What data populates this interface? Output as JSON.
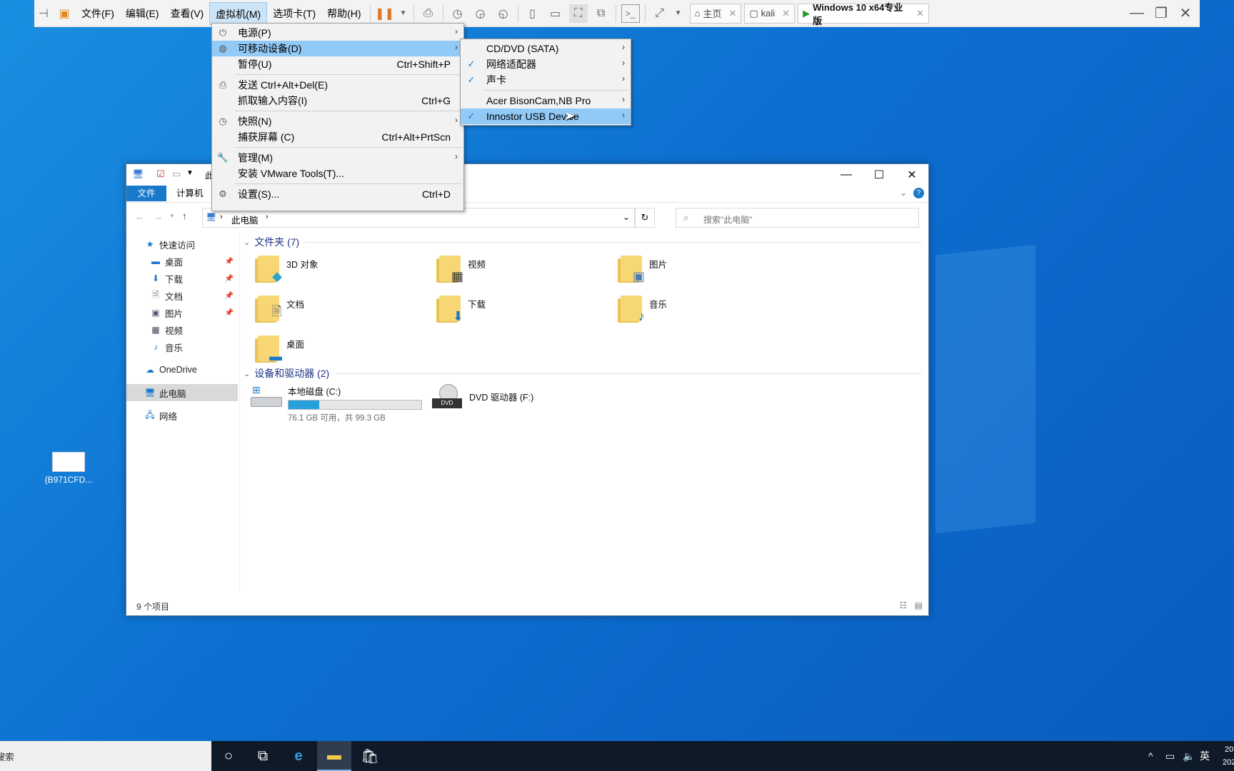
{
  "vmware": {
    "menus": [
      "文件(F)",
      "编辑(E)",
      "查看(V)",
      "虚拟机(M)",
      "选项卡(T)",
      "帮助(H)"
    ],
    "tabs": [
      {
        "label": "主页"
      },
      {
        "label": "kali"
      },
      {
        "label": "Windows 10 x64专业版"
      }
    ]
  },
  "vm_menu": {
    "items": [
      {
        "label": "电源(P)",
        "shortcut": "",
        "submenu": true,
        "icon": "power-icon"
      },
      {
        "label": "可移动设备(D)",
        "shortcut": "",
        "submenu": true,
        "icon": "removable-device-icon"
      },
      {
        "label": "暂停(U)",
        "shortcut": "Ctrl+Shift+P",
        "submenu": false
      },
      {
        "label": "发送 Ctrl+Alt+Del(E)",
        "shortcut": "",
        "submenu": false,
        "icon": "keyboard-send-icon"
      },
      {
        "label": "抓取输入内容(I)",
        "shortcut": "Ctrl+G",
        "submenu": false
      },
      {
        "label": "快照(N)",
        "shortcut": "",
        "submenu": true,
        "icon": "snapshot-icon"
      },
      {
        "label": "捕获屏幕 (C)",
        "shortcut": "Ctrl+Alt+PrtScn",
        "submenu": false
      },
      {
        "label": "管理(M)",
        "shortcut": "",
        "submenu": true,
        "icon": "wrench-icon"
      },
      {
        "label": "安装 VMware Tools(T)...",
        "shortcut": "",
        "submenu": false
      },
      {
        "label": "设置(S)...",
        "shortcut": "Ctrl+D",
        "submenu": false,
        "icon": "settings-icon"
      }
    ]
  },
  "device_menu": {
    "items": [
      {
        "label": "CD/DVD (SATA)",
        "checked": false
      },
      {
        "label": "网络适配器",
        "checked": true
      },
      {
        "label": "声卡",
        "checked": true
      },
      {
        "label": "Acer BisonCam,NB Pro",
        "checked": false
      },
      {
        "label": "Innostor USB Device",
        "checked": true
      }
    ]
  },
  "explorer": {
    "title_short": "此",
    "ribbon_tabs": [
      "文件",
      "计算机"
    ],
    "breadcrumb": "此电脑",
    "search_placeholder": "搜索\"此电脑\"",
    "nav": {
      "quick_access": "快速访问",
      "items": [
        "桌面",
        "下载",
        "文档",
        "图片",
        "视频",
        "音乐"
      ],
      "onedrive": "OneDrive",
      "this_pc": "此电脑",
      "network": "网络"
    },
    "folders_header": "文件夹 (7)",
    "folders": [
      "3D 对象",
      "视频",
      "图片",
      "文档",
      "下载",
      "音乐",
      "桌面"
    ],
    "drives_header": "设备和驱动器 (2)",
    "drives": [
      {
        "name": "本地磁盘 (C:)",
        "info": "76.1 GB 可用，共 99.3 GB",
        "used_fraction": 0.23
      },
      {
        "name": "DVD 驱动器 (F:)"
      }
    ],
    "status": "9 个项目"
  },
  "desktop_icon": {
    "label": "{B971CFD..."
  },
  "taskbar": {
    "search_text": "搜索",
    "ime": "英"
  }
}
